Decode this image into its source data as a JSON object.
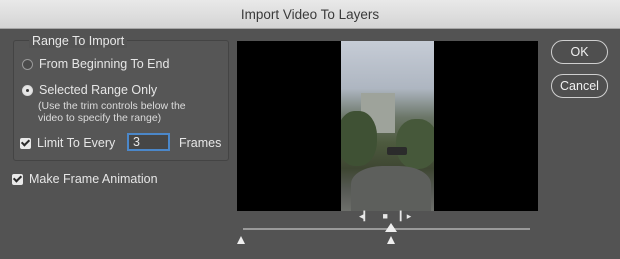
{
  "window": {
    "title": "Import Video To Layers"
  },
  "range_group": {
    "legend": "Range To Import",
    "options": [
      {
        "label": "From Beginning To End",
        "selected": false
      },
      {
        "label": "Selected Range Only",
        "selected": true
      }
    ],
    "hint_line1": "(Use the trim controls below the",
    "hint_line2": "video to specify the range)",
    "limit_label": "Limit To Every",
    "limit_checked": true,
    "limit_value": "3",
    "frames_label": "Frames"
  },
  "make_frame_animation": {
    "label": "Make Frame Animation",
    "checked": true
  },
  "buttons": {
    "ok": "OK",
    "cancel": "Cancel"
  },
  "playback": {
    "prev_icon": "◂▎",
    "stop_icon": "■",
    "next_icon": "▎▸"
  }
}
